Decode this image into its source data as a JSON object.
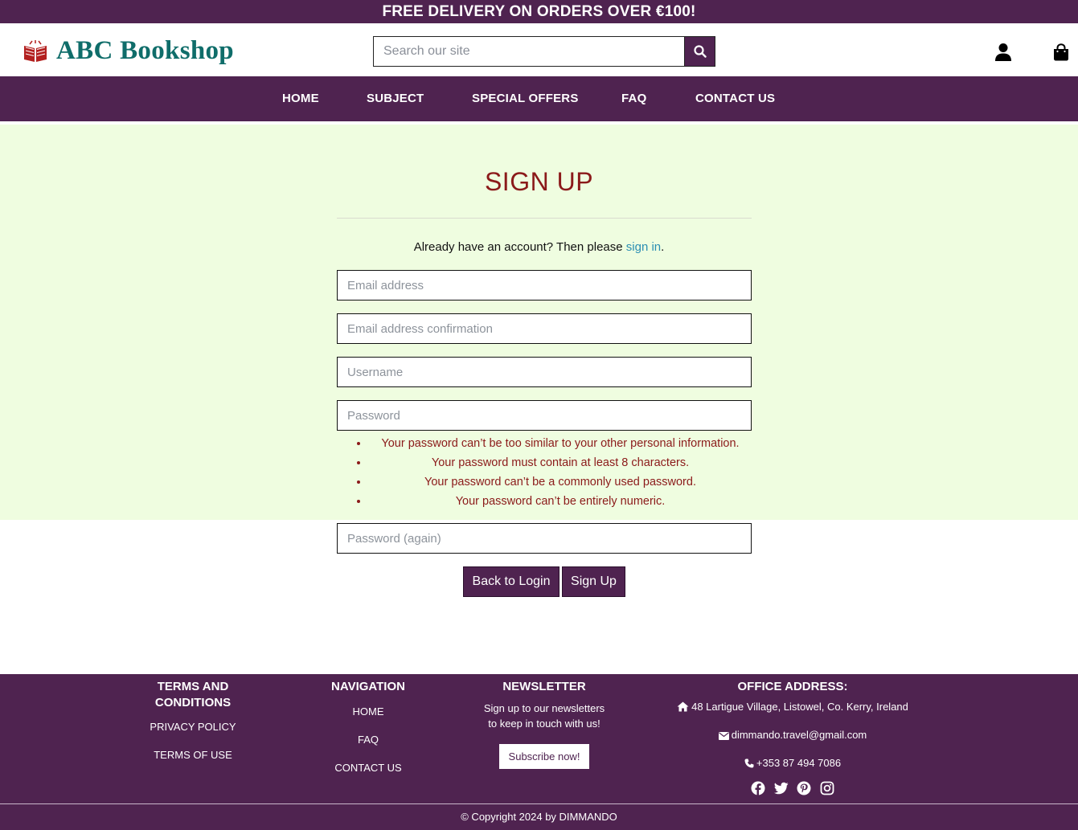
{
  "banner": {
    "text": "FREE DELIVERY ON ORDERS OVER €100!"
  },
  "header": {
    "logo_text": "ABC Bookshop",
    "search_placeholder": "Search our site",
    "icons": {
      "search": "search-icon",
      "account": "user-icon",
      "cart": "shopping-bag-icon"
    }
  },
  "nav": {
    "items": [
      "HOME",
      "SUBJECT",
      "SPECIAL OFFERS",
      "FAQ",
      "CONTACT US"
    ]
  },
  "signup": {
    "title": "SIGN UP",
    "already_text": "Already have an account? Then please",
    "signin_link": "sign in",
    "fields": {
      "email": "Email address",
      "email_confirm": "Email address confirmation",
      "username": "Username",
      "password": "Password",
      "password_again": "Password (again)"
    },
    "password_help": [
      "Your password can’t be too similar to your other personal information.",
      "Your password must contain at least 8 characters.",
      "Your password can’t be a commonly used password.",
      "Your password can’t be entirely numeric."
    ],
    "back_button": "Back to Login",
    "signup_button": "Sign Up"
  },
  "footer": {
    "terms": {
      "heading": "TERMS AND CONDITIONS",
      "links": [
        "PRIVACY POLICY",
        "TERMS OF USE"
      ]
    },
    "navigation": {
      "heading": "NAVIGATION",
      "links": [
        "HOME",
        "FAQ",
        "CONTACT US"
      ]
    },
    "newsletter": {
      "heading": "NEWSLETTER",
      "text_line1": "Sign up to our newsletters",
      "text_line2": "to keep in touch with us!",
      "button": "Subscribe now!"
    },
    "office": {
      "heading": "OFFICE ADDRESS:",
      "address": "48 Lartigue Village, Listowel, Co. Kerry, Ireland",
      "email": "dimmando.travel@gmail.com",
      "phone": "+353 87 494 7086",
      "social": [
        "facebook-icon",
        "twitter-icon",
        "pinterest-icon",
        "instagram-icon"
      ]
    },
    "copyright": "© Copyright 2024 by DIMMANDO"
  },
  "colors": {
    "brand": "#4f2350",
    "accent_red": "#8b1a1a",
    "logo_teal": "#0f6d6a",
    "link": "#2b8fb3",
    "form_bg": "#effde0"
  }
}
